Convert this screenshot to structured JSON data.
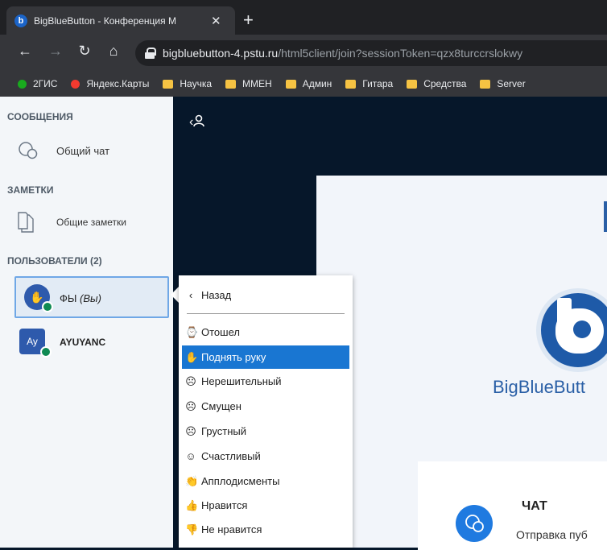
{
  "browser": {
    "tab_title": "BigBlueButton - Конференция М",
    "tab_favicon": "b",
    "new_tab": "+",
    "url_host": "bigbluebutton-4.pstu.ru",
    "url_path": "/html5client/join?sessionToken=qzx8turccrslokwy",
    "bookmarks": [
      {
        "label": "2ГИС",
        "kind": "pin",
        "color": "#19AA1E"
      },
      {
        "label": "Яндекс.Карты",
        "kind": "pin",
        "color": "#F33A2F"
      },
      {
        "label": "Научка",
        "kind": "folder"
      },
      {
        "label": "ММЕН",
        "kind": "folder"
      },
      {
        "label": "Админ",
        "kind": "folder"
      },
      {
        "label": "Гитара",
        "kind": "folder"
      },
      {
        "label": "Средства",
        "kind": "folder"
      },
      {
        "label": "Server",
        "kind": "folder"
      }
    ]
  },
  "sidebar": {
    "messages_title": "СООБЩЕНИЯ",
    "public_chat": "Общий чат",
    "notes_title": "ЗАМЕТКИ",
    "shared_notes": "Общие заметки",
    "users_title": "ПОЛЬЗОВАТЕЛИ (2)",
    "users": [
      {
        "name": "ФЫ",
        "suffix": "(Вы)",
        "avatar": "hand-icon"
      },
      {
        "name": "AYUYANC",
        "suffix": "",
        "avatar": "Ay"
      }
    ]
  },
  "menu": {
    "back": "Назад",
    "items": [
      {
        "icon": "⌚",
        "label": "Отошел",
        "name": "away"
      },
      {
        "icon": "✋",
        "label": "Поднять руку",
        "name": "raise-hand",
        "active": true
      },
      {
        "icon": "☹",
        "label": "Нерешительный",
        "name": "undecided"
      },
      {
        "icon": "☹",
        "label": "Смущен",
        "name": "confused"
      },
      {
        "icon": "☹",
        "label": "Грустный",
        "name": "sad"
      },
      {
        "icon": "☺",
        "label": "Счастливый",
        "name": "happy"
      },
      {
        "icon": "👏",
        "label": "Апплодисменты",
        "name": "applause"
      },
      {
        "icon": "👍",
        "label": "Нравится",
        "name": "like"
      },
      {
        "icon": "👎",
        "label": "Не нравится",
        "name": "dislike"
      }
    ]
  },
  "main": {
    "toggle_users": "‹",
    "logo_text": "BigBlueButt",
    "chat_title": "ЧАТ",
    "chat_text": "Отправка пуб"
  },
  "colors": {
    "accent": "#1976D2",
    "main_bg": "#06172A",
    "sidebar_bg": "#F3F6F9"
  }
}
